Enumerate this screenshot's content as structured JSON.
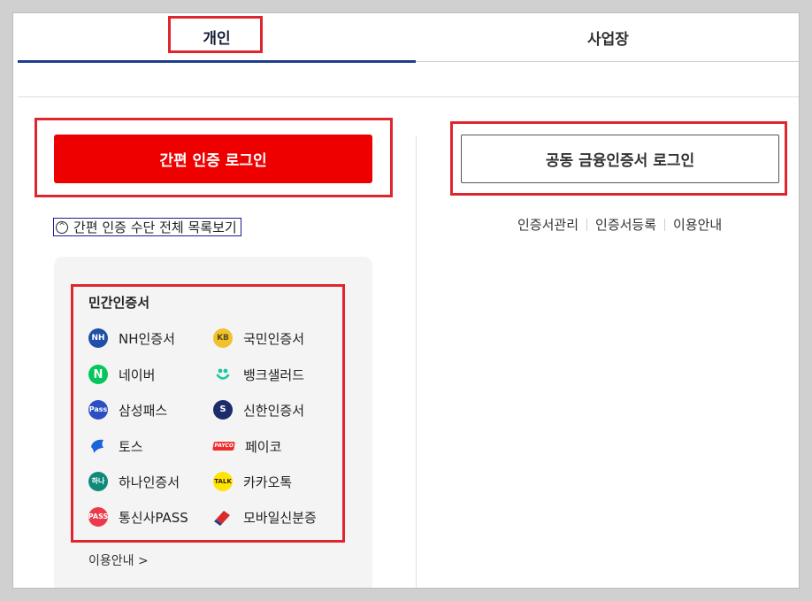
{
  "tabs": {
    "personal": "개인",
    "business": "사업장"
  },
  "buttons": {
    "simple_login": "간편 인증 로그인",
    "cert_login": "공동 금융인증서 로그인"
  },
  "expand_link": {
    "label": "간편 인증 수단 전체 목록보기",
    "icon": "^"
  },
  "cert_links": [
    "인증서관리",
    "인증서등록",
    "이용안내"
  ],
  "private_certs": {
    "title": "민간인증서",
    "items": [
      {
        "label": "NH인증서",
        "icon": "nh-icon",
        "color": "#1f4fa8"
      },
      {
        "label": "국민인증서",
        "icon": "kb-icon",
        "color": "#f2c12e"
      },
      {
        "label": "네이버",
        "icon": "naver-icon",
        "color": "#03c75a"
      },
      {
        "label": "뱅크샐러드",
        "icon": "banksalad-icon",
        "color": "#1fc7a6"
      },
      {
        "label": "삼성패스",
        "icon": "samsung-pass-icon",
        "color": "#2b4ec2"
      },
      {
        "label": "신한인증서",
        "icon": "shinhan-icon",
        "color": "#1c2c6b"
      },
      {
        "label": "토스",
        "icon": "toss-icon",
        "color": "#1b64da"
      },
      {
        "label": "페이코",
        "icon": "payco-icon",
        "color": "#ef2b2b"
      },
      {
        "label": "하나인증서",
        "icon": "hana-icon",
        "color": "#0f8a7a"
      },
      {
        "label": "카카오톡",
        "icon": "kakaotalk-icon",
        "color": "#fee500"
      },
      {
        "label": "통신사PASS",
        "icon": "pass-icon",
        "color": "#ea3a4b"
      },
      {
        "label": "모바일신분증",
        "icon": "mobile-id-icon",
        "color": "#d82a2a"
      }
    ],
    "guide": "이용안내 >"
  },
  "icon_text": {
    "nh": "NH",
    "kb": "KB",
    "naver": "N",
    "samsung": "Pass",
    "shinhan": "S",
    "payco": "PAYCO",
    "hana": "하나",
    "kakao": "TALK",
    "pass": "PASS"
  },
  "colors": {
    "accent_red": "#ee0000",
    "tab_underline": "#1e3d8c",
    "highlight_box": "#e0262d"
  }
}
